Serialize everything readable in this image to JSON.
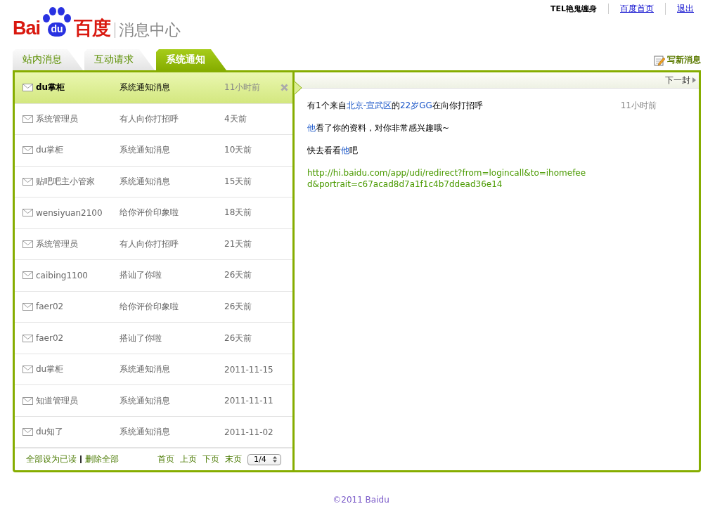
{
  "header": {
    "logo": {
      "left": "Bai",
      "badge": "du",
      "right": "百度"
    },
    "section_title": "消息中心",
    "user": "TEL艳鬼缠身",
    "links": [
      "百度首页",
      "退出"
    ]
  },
  "tabs": [
    {
      "label": "站内消息",
      "selected": false
    },
    {
      "label": "互动请求",
      "selected": false
    },
    {
      "label": "系统通知",
      "selected": true
    }
  ],
  "compose": "写新消息",
  "messages": [
    {
      "sender": "du掌柜",
      "subject": "系统通知消息",
      "time": "11小时前",
      "selected": true
    },
    {
      "sender": "系统管理员",
      "subject": "有人向你打招呼",
      "time": "4天前",
      "selected": false
    },
    {
      "sender": "du掌柜",
      "subject": "系统通知消息",
      "time": "10天前",
      "selected": false
    },
    {
      "sender": "贴吧吧主小管家",
      "subject": "系统通知消息",
      "time": "15天前",
      "selected": false
    },
    {
      "sender": "wensiyuan2100",
      "subject": "给你评价印象啦",
      "time": "18天前",
      "selected": false
    },
    {
      "sender": "系统管理员",
      "subject": "有人向你打招呼",
      "time": "21天前",
      "selected": false
    },
    {
      "sender": "caibing1100",
      "subject": "搭讪了你啦",
      "time": "26天前",
      "selected": false
    },
    {
      "sender": "faer02",
      "subject": "给你评价印象啦",
      "time": "26天前",
      "selected": false
    },
    {
      "sender": "faer02",
      "subject": "搭讪了你啦",
      "time": "26天前",
      "selected": false
    },
    {
      "sender": "du掌柜",
      "subject": "系统通知消息",
      "time": "2011-11-15",
      "selected": false
    },
    {
      "sender": "知道管理员",
      "subject": "系统通知消息",
      "time": "2011-11-11",
      "selected": false
    },
    {
      "sender": "du知了",
      "subject": "系统通知消息",
      "time": "2011-11-02",
      "selected": false
    }
  ],
  "list_footer": {
    "actions": [
      "全部设为已读",
      "删除全部"
    ],
    "pager": [
      "首页",
      "上页",
      "下页",
      "末页"
    ],
    "page": "1/4"
  },
  "detail": {
    "next": "下一封",
    "time": "11小时前",
    "paragraphs": [
      [
        {
          "text": "有1个来自",
          "kind": "plain"
        },
        {
          "text": "北京-宣武区",
          "kind": "link"
        },
        {
          "text": "的",
          "kind": "plain"
        },
        {
          "text": "22岁GG",
          "kind": "link"
        },
        {
          "text": "在向你打招呼",
          "kind": "plain"
        }
      ],
      [
        {
          "text": "他",
          "kind": "link"
        },
        {
          "text": "看了你的资料，对你非常感兴趣哦~",
          "kind": "plain"
        }
      ],
      [
        {
          "text": "快去看看",
          "kind": "plain"
        },
        {
          "text": "他",
          "kind": "link"
        },
        {
          "text": "吧",
          "kind": "plain"
        }
      ]
    ],
    "url": "http://hi.baidu.com/app/udi/redirect?from=logincall&to=ihomefeed&portrait=c67acad8d7a1f1c4b7ddead36e14"
  },
  "footer": "©2011 Baidu"
}
